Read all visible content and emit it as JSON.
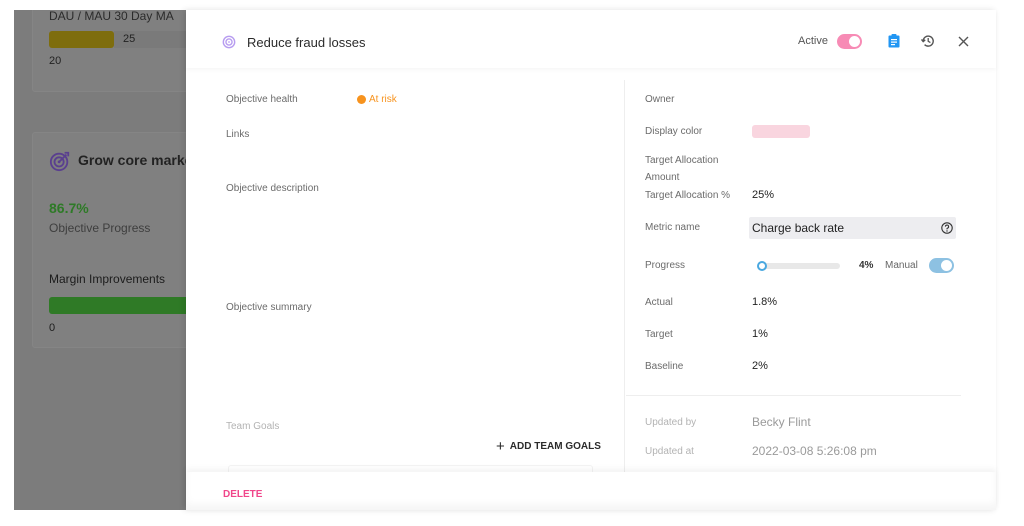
{
  "background": {
    "card1": {
      "title_partial": "DAU / MAU 30 Day MA",
      "bar_value": "25",
      "min_value": "20",
      "bar_color": "#e0c21a"
    },
    "card2": {
      "icon": "target-icon",
      "title": "Grow core market",
      "progress_percent": "86.7%",
      "progress_label": "Objective Progress",
      "key_result": "Margin Improvements",
      "key_result_min": "0",
      "key_result_color": "#4caf50"
    }
  },
  "drawer": {
    "header": {
      "icon": "target-icon",
      "title": "Reduce fraud losses",
      "active_label": "Active",
      "active_on": true,
      "icons": [
        "clipboard-icon",
        "history-icon",
        "close-icon"
      ]
    },
    "left": {
      "health_label": "Objective health",
      "health_value": "At risk",
      "health_color": "#f7931e",
      "links_label": "Links",
      "description_label": "Objective description",
      "summary_label": "Objective summary",
      "team_goals_label": "Team Goals",
      "add_team_goals": "ADD TEAM GOALS"
    },
    "right": {
      "owner_label": "Owner",
      "display_color_label": "Display color",
      "display_color": "#f9d5df",
      "target_alloc_amount_label_1": "Target Allocation",
      "target_alloc_amount_label_2": "Amount",
      "target_alloc_pct_label": "Target Allocation %",
      "target_alloc_pct": "25%",
      "metric_name_label": "Metric name",
      "metric_name": "Charge back rate",
      "progress_label": "Progress",
      "progress_value": "4%",
      "progress_fraction": 0.04,
      "manual_label": "Manual",
      "manual_on": true,
      "actual_label": "Actual",
      "actual": "1.8%",
      "target_label": "Target",
      "target": "1%",
      "baseline_label": "Baseline",
      "baseline": "2%",
      "updated_by_label": "Updated by",
      "updated_by": "Becky Flint",
      "updated_at_label": "Updated at",
      "updated_at": "2022-03-08 5:26:08 pm"
    },
    "footer": {
      "delete_label": "DELETE"
    }
  },
  "colors": {
    "accent_pink": "#f0468a",
    "toggle_pink": "#f78bb5",
    "toggle_blue": "#8dc1e2",
    "icon_blue": "#2196f3",
    "target_purple": "#a98be8"
  }
}
